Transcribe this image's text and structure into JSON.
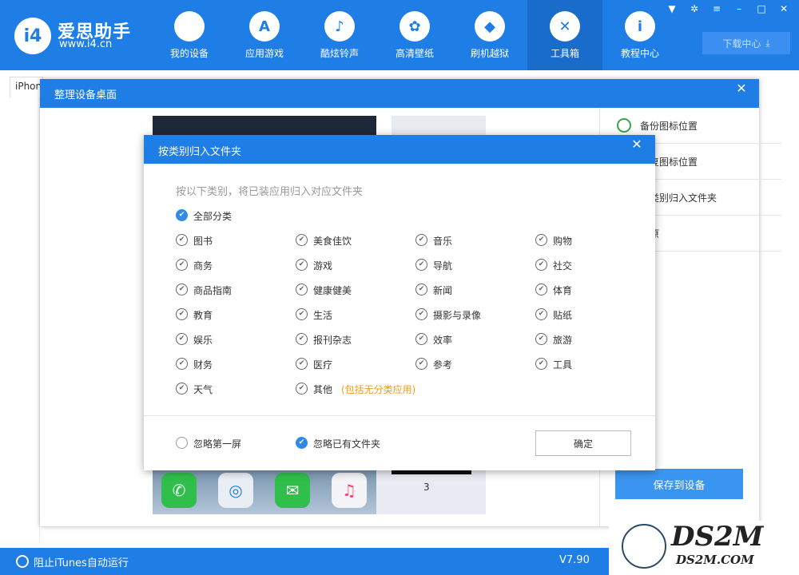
{
  "app": {
    "brand_name": "爱思助手",
    "brand_url": "www.i4.cn",
    "logo_text": "i4"
  },
  "nav": [
    {
      "label": "我的设备",
      "icon": "apple-icon"
    },
    {
      "label": "应用游戏",
      "icon": "app-store-icon"
    },
    {
      "label": "酷炫铃声",
      "icon": "bell-icon"
    },
    {
      "label": "高清壁纸",
      "icon": "flower-icon"
    },
    {
      "label": "刷机越狱",
      "icon": "dropbox-icon"
    },
    {
      "label": "工具箱",
      "icon": "tools-icon",
      "active": true
    },
    {
      "label": "教程中心",
      "icon": "info-icon"
    }
  ],
  "download_center": "下载中心",
  "background": {
    "tab_label": "iPhone"
  },
  "status": {
    "itunes_label": "阻止iTunes自动运行",
    "version": "V7.90"
  },
  "watermark": {
    "big": "DS2M",
    "small": "DS2M.COM"
  },
  "outer_dialog": {
    "title": "整理设备桌面",
    "side_items": [
      "备份图标位置",
      "恢复图标位置",
      "按类别归入文件夹",
      "还原"
    ],
    "save_button": "保存到设备",
    "page_number": "3"
  },
  "inner_dialog": {
    "title": "按类别归入文件夹",
    "hint": "按以下类别，将已装应用归入对应文件夹",
    "all_label": "全部分类",
    "categories": [
      [
        "图书",
        "美食佳饮",
        "音乐",
        "购物"
      ],
      [
        "商务",
        "游戏",
        "导航",
        "社交"
      ],
      [
        "商品指南",
        "健康健美",
        "新闻",
        "体育"
      ],
      [
        "教育",
        "生活",
        "摄影与录像",
        "贴纸"
      ],
      [
        "娱乐",
        "报刊杂志",
        "效率",
        "旅游"
      ],
      [
        "财务",
        "医疗",
        "参考",
        "工具"
      ],
      [
        "天气",
        "其他",
        "",
        ""
      ]
    ],
    "note": "(包括无分类应用)",
    "ignore_first_screen": "忽略第一屏",
    "ignore_existing_folders": "忽略已有文件夹",
    "confirm": "确定"
  },
  "colors": {
    "primary": "#1f7de6",
    "accent_orange": "#f09b1c"
  }
}
